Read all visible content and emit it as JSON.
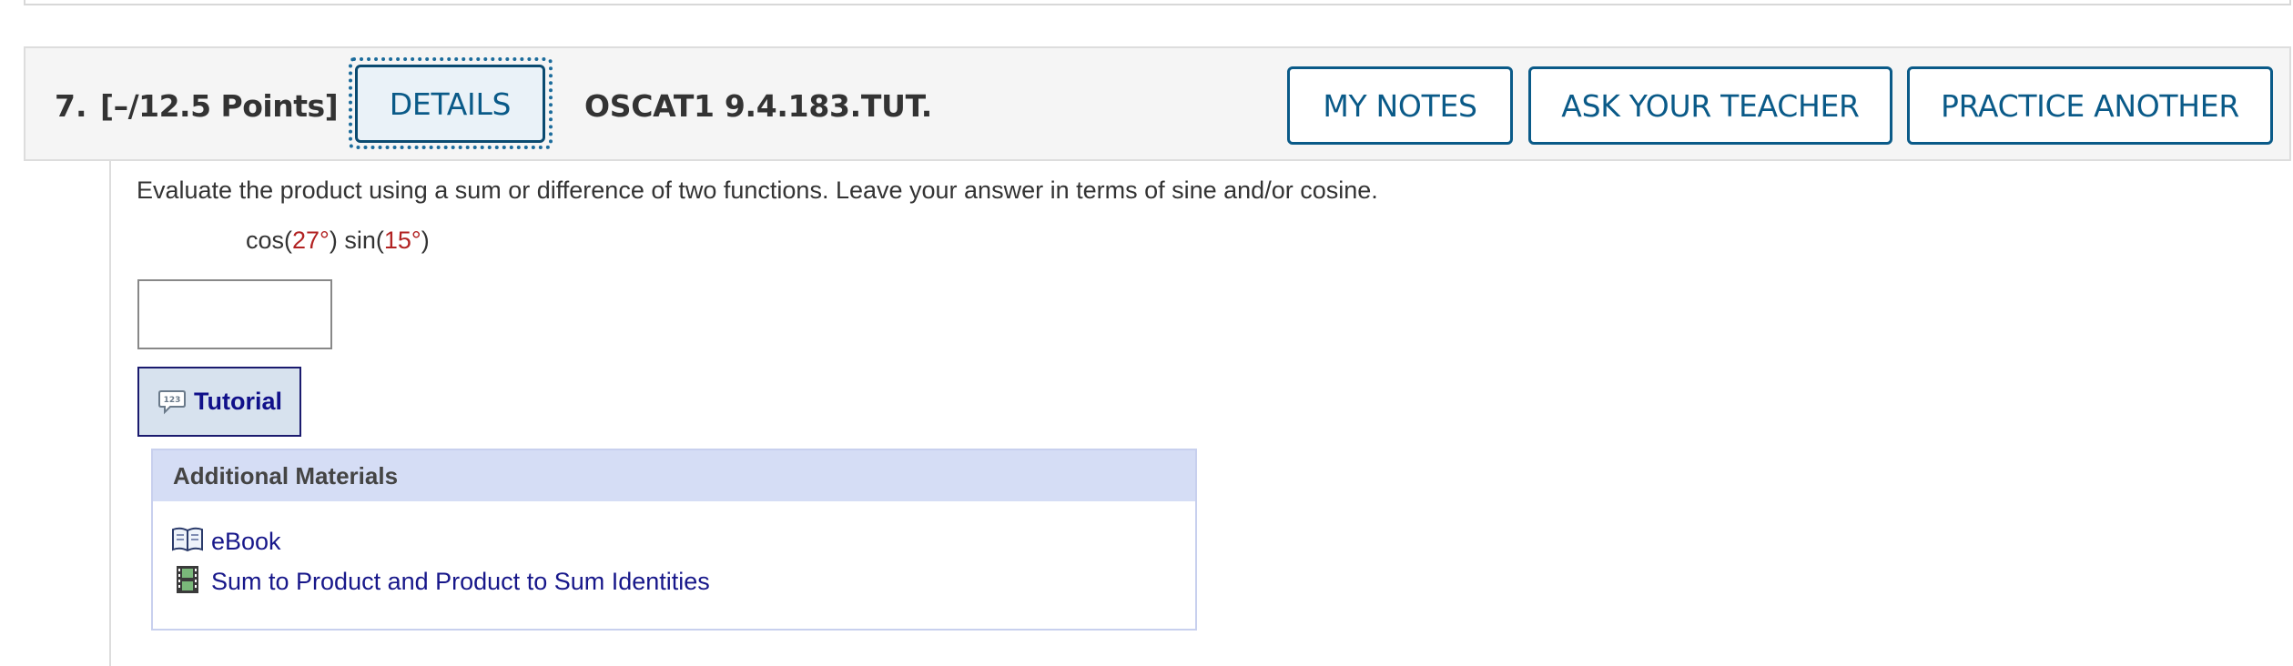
{
  "question": {
    "number": "7.",
    "points": "[–/12.5 Points]",
    "details_label": "DETAILS",
    "code": "OSCAT1 9.4.183.TUT.",
    "my_notes_label": "MY NOTES",
    "ask_teacher_label": "ASK YOUR TEACHER",
    "practice_another_label": "PRACTICE ANOTHER"
  },
  "body": {
    "prompt": "Evaluate the product using a sum or difference of two functions. Leave your answer in terms of sine and/or cosine.",
    "expression": {
      "cos_prefix": "cos(",
      "cos_value": "27°",
      "mid": ") sin(",
      "sin_value": "15°",
      "suffix": ")"
    },
    "answer_value": "",
    "tutorial_label": "Tutorial"
  },
  "materials": {
    "header": "Additional Materials",
    "items": [
      {
        "icon": "book-icon",
        "label": "eBook"
      },
      {
        "icon": "film-icon",
        "label": "Sum to Product and Product to Sum Identities"
      }
    ]
  },
  "colors": {
    "accent": "#0a5a88",
    "link": "#17178a",
    "red_value": "#b22222",
    "materials_header_bg": "#d5ddf5"
  }
}
